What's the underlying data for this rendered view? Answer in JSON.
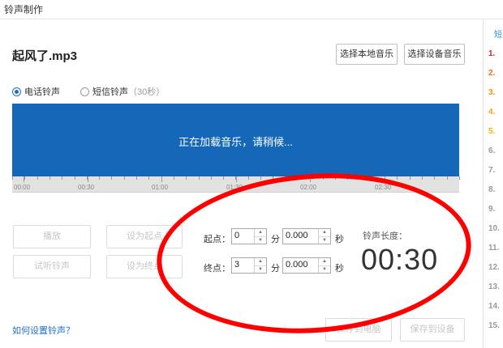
{
  "window": {
    "title": "铃声制作"
  },
  "file": {
    "name": "起风了.mp3"
  },
  "buttons": {
    "select_local": "选择本地音乐",
    "select_device": "选择设备音乐",
    "play": "播放",
    "set_start": "设为起点",
    "preview": "试听铃声",
    "set_end": "设为终点",
    "save_pc": "保存到电脑",
    "save_device": "保存到设备"
  },
  "ringtype": {
    "call_label": "电话铃声",
    "sms_label": "短信铃声",
    "sms_hint": "（30秒）",
    "selected": "电话铃声"
  },
  "waveform": {
    "loading_text": "正在加载音乐，请稍候...",
    "bg_color": "#1567b8",
    "ticks": [
      "00:00",
      "00:30",
      "01:00",
      "01:30",
      "02:00",
      "02:30"
    ]
  },
  "range": {
    "start_label": "起点：",
    "end_label": "终点：",
    "start_min": "0",
    "start_sec": "0.000",
    "end_min": "3",
    "end_sec": "0.000",
    "min_unit": "分",
    "sec_unit": "秒"
  },
  "length": {
    "label": "铃声长度：",
    "value": "00:30"
  },
  "help": {
    "link": "如何设置铃声？"
  },
  "right_panel": {
    "title": "短",
    "items": [
      {
        "n": "1.",
        "color": "#e02020"
      },
      {
        "n": "2.",
        "color": "#ff6a00"
      },
      {
        "n": "3.",
        "color": "#ff8c00"
      },
      {
        "n": "4.",
        "color": "#ff9f1a"
      },
      {
        "n": "5.",
        "color": "#ffb000"
      },
      {
        "n": "6.",
        "color": "#999999"
      },
      {
        "n": "7.",
        "color": "#999999"
      },
      {
        "n": "8.",
        "color": "#999999"
      },
      {
        "n": "9.",
        "color": "#999999"
      },
      {
        "n": "10.",
        "color": "#999999"
      },
      {
        "n": "11.",
        "color": "#999999"
      },
      {
        "n": "12.",
        "color": "#999999"
      },
      {
        "n": "13.",
        "color": "#999999"
      },
      {
        "n": "14.",
        "color": "#999999"
      },
      {
        "n": "15.",
        "color": "#999999"
      }
    ]
  },
  "annotation": {
    "color": "#ff0000",
    "shape": "ellipse"
  }
}
